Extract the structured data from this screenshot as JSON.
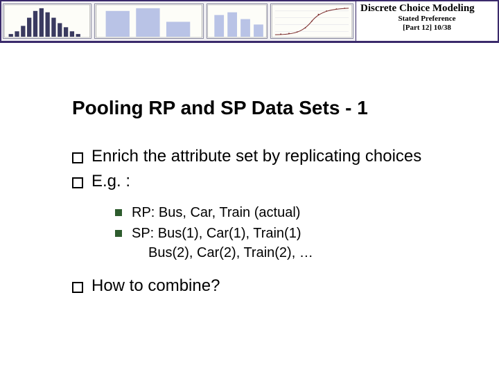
{
  "header": {
    "course_title": "Discrete Choice Modeling",
    "subtitle": "Stated Preference",
    "part_label": "[Part 12]   10/38"
  },
  "slide": {
    "title": "Pooling RP and SP Data Sets  - 1",
    "bullets": {
      "b1": "Enrich the attribute set by replicating choices",
      "b2": "E.g. :",
      "sub1": "RP: Bus, Car, Train  (actual)",
      "sub2": "SP: Bus(1), Car(1), Train(1)",
      "sub2b": "Bus(2), Car(2), Train(2), …",
      "b3": "How to combine?"
    }
  }
}
